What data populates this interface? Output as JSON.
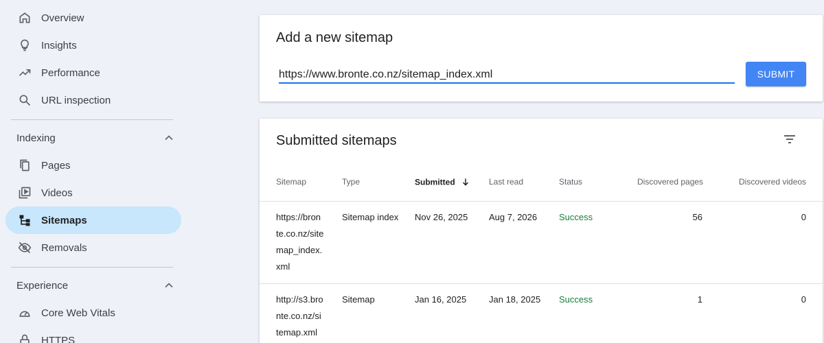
{
  "sidebar": {
    "top_items": [
      {
        "label": "Overview",
        "icon": "home-icon"
      },
      {
        "label": "Insights",
        "icon": "lightbulb-icon"
      },
      {
        "label": "Performance",
        "icon": "trending-up-icon"
      },
      {
        "label": "URL inspection",
        "icon": "search-icon"
      }
    ],
    "indexing": {
      "header": "Indexing",
      "items": [
        {
          "label": "Pages",
          "icon": "pages-icon"
        },
        {
          "label": "Videos",
          "icon": "video-icon"
        },
        {
          "label": "Sitemaps",
          "icon": "sitemap-icon"
        },
        {
          "label": "Removals",
          "icon": "eye-off-icon"
        }
      ]
    },
    "experience": {
      "header": "Experience",
      "items": [
        {
          "label": "Core Web Vitals",
          "icon": "speed-icon"
        },
        {
          "label": "HTTPS",
          "icon": "lock-icon"
        }
      ]
    },
    "active_color": "#c8e6fc"
  },
  "add_sitemap": {
    "title": "Add a new sitemap",
    "input_value": "https://www.bronte.co.nz/sitemap_index.xml",
    "submit_label": "SUBMIT",
    "accent_color": "#4285f4"
  },
  "submitted": {
    "title": "Submitted sitemaps",
    "columns": [
      "Sitemap",
      "Type",
      "Submitted",
      "Last read",
      "Status",
      "Discovered pages",
      "Discovered videos"
    ],
    "rows": [
      {
        "sitemap_lines": [
          "https://bron",
          "te.co.nz/site",
          "map_index.",
          "xml"
        ],
        "type": "Sitemap index",
        "submitted": "Nov 26, 2025",
        "last_read": "Aug 7, 2026",
        "status": "Success",
        "pages": "56",
        "videos": "0"
      },
      {
        "sitemap_lines": [
          "http://s3.bro",
          "nte.co.nz/si",
          "temap.xml"
        ],
        "type": "Sitemap",
        "submitted": "Jan 16, 2025",
        "last_read": "Jan 18, 2025",
        "status": "Success",
        "pages": "1",
        "videos": "0"
      }
    ],
    "status_color": "#188038"
  }
}
